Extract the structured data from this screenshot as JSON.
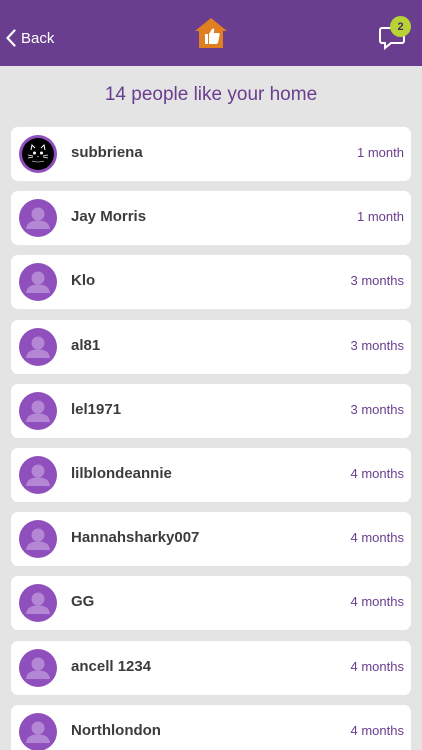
{
  "header": {
    "back_label": "Back",
    "logo_icon": "home-thumbs-up-icon",
    "chat_icon": "chat-bubble-icon",
    "notification_count": "2",
    "colors": {
      "bar": "#6a3e8e",
      "logo": "#e07f1f",
      "badge": "#b7d335"
    }
  },
  "page": {
    "title": "14 people like your home"
  },
  "likes": [
    {
      "username": "subbriena",
      "time": "1 month",
      "avatar": "cat-avatar"
    },
    {
      "username": "Jay Morris",
      "time": "1 month",
      "avatar": "default-user-icon"
    },
    {
      "username": "Klo",
      "time": "3 months",
      "avatar": "default-user-icon"
    },
    {
      "username": "al81",
      "time": "3 months",
      "avatar": "default-user-icon"
    },
    {
      "username": "lel1971",
      "time": "3 months",
      "avatar": "default-user-icon"
    },
    {
      "username": "lilblondeannie",
      "time": "4 months",
      "avatar": "default-user-icon"
    },
    {
      "username": "Hannahsharky007",
      "time": "4 months",
      "avatar": "default-user-icon"
    },
    {
      "username": "GG",
      "time": "4 months",
      "avatar": "default-user-icon"
    },
    {
      "username": "ancell 1234",
      "time": "4 months",
      "avatar": "default-user-icon"
    },
    {
      "username": "Northlondon",
      "time": "4 months",
      "avatar": "default-user-icon"
    }
  ]
}
